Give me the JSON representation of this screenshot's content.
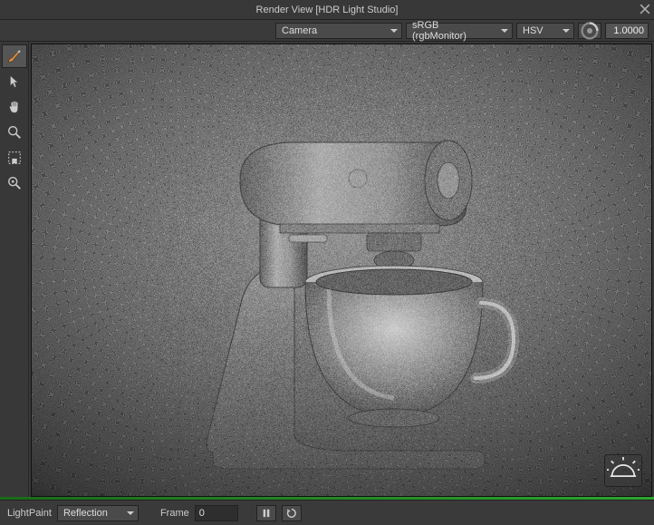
{
  "title": "Render View [HDR Light Studio]",
  "topbar": {
    "camera": {
      "label": "Camera"
    },
    "colorspace": {
      "label": "sRGB (rgbMonitor)"
    },
    "colormode": {
      "label": "HSV"
    },
    "exposure": "1.0000"
  },
  "tools": {
    "brush": "brush-tool",
    "pointer": "pointer-tool",
    "hand": "hand-tool",
    "zoom": "zoom-tool",
    "region": "region-tool",
    "pick": "pick-tool"
  },
  "overlay": {
    "sun": "sun-overlay"
  },
  "bottombar": {
    "mode_label": "LightPaint",
    "mode_value": "Reflection",
    "frame_label": "Frame",
    "frame_value": "0"
  }
}
